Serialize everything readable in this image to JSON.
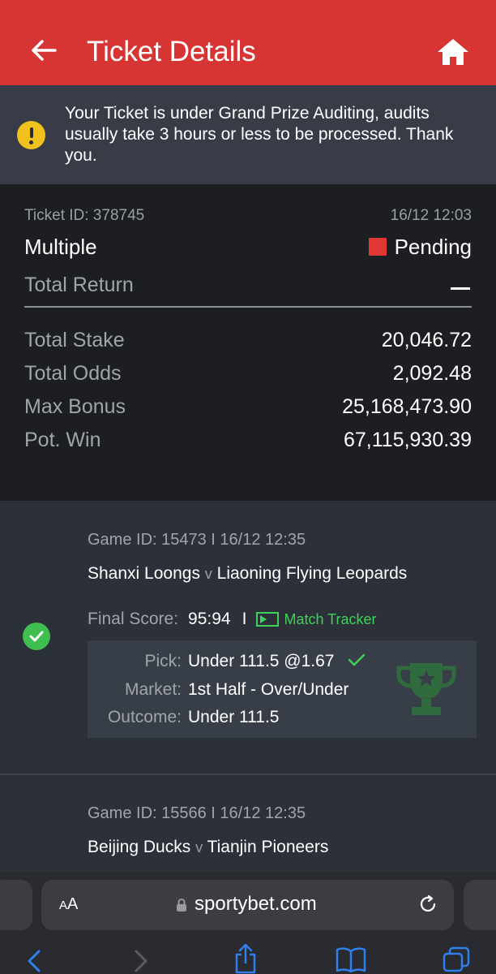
{
  "header": {
    "title": "Ticket Details",
    "back_icon": "arrow-left-icon",
    "home_icon": "home-icon",
    "bg": "#d73434"
  },
  "notice": {
    "text": "Your Ticket is under Grand Prize Auditing, audits usually take 3 hours or less to be processed. Thank you.",
    "icon": "warning-icon",
    "icon_color": "#f1c21b"
  },
  "ticket": {
    "id_label": "Ticket ID: 378745",
    "datetime": "16/12 12:03",
    "type": "Multiple",
    "status": "Pending",
    "status_color": "#e03636",
    "total_return_label": "Total Return",
    "total_stake_label": "Total Stake",
    "total_stake": "20,046.72",
    "total_odds_label": "Total Odds",
    "total_odds": "2,092.48",
    "max_bonus_label": "Max Bonus",
    "max_bonus": "25,168,473.90",
    "pot_win_label": "Pot. Win",
    "pot_win": "67,115,930.39"
  },
  "games": [
    {
      "meta": "Game ID: 15473 I 16/12 12:35",
      "home": "Shanxi Loongs",
      "vs": "v",
      "away": "Liaoning Flying Leopards",
      "final_score_label": "Final Score:",
      "final_score": "95:94",
      "separator": "I",
      "tracker_label": "Match Tracker",
      "pick_label": "Pick:",
      "pick": "Under 111.5 @1.67",
      "market_label": "Market:",
      "market": "1st Half - Over/Under",
      "outcome_label": "Outcome:",
      "outcome": "Under 111.5",
      "won": true
    },
    {
      "meta": "Game ID: 15566 I 16/12 12:35",
      "home": "Beijing Ducks",
      "vs": "v",
      "away": "Tianjin Pioneers"
    }
  ],
  "browser": {
    "aa_small": "A",
    "aa_big": "A",
    "url": "sportybet.com"
  },
  "colors": {
    "accent_green": "#3fd25a",
    "success": "#3fbf50"
  }
}
